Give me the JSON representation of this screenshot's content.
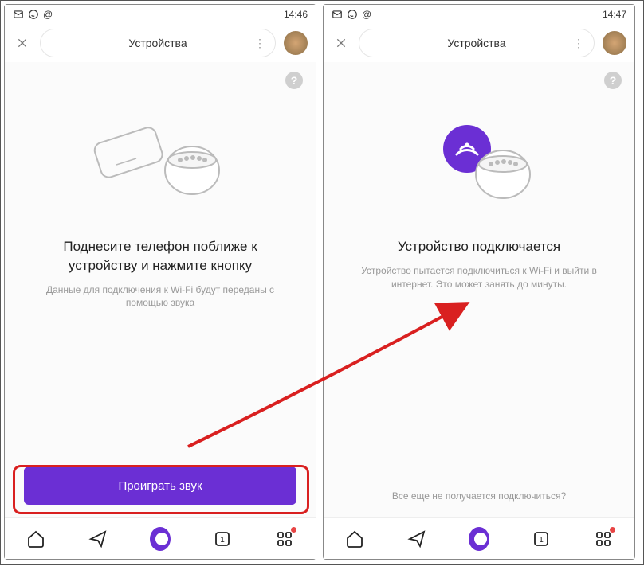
{
  "left": {
    "status": {
      "time": "14:46"
    },
    "header": {
      "title": "Устройства"
    },
    "title": "Поднесите телефон поближе к устройству и нажмите кнопку",
    "subtitle": "Данные для подключения к Wi-Fi будут переданы с помощью звука",
    "button": "Проиграть звук"
  },
  "right": {
    "status": {
      "time": "14:47"
    },
    "header": {
      "title": "Устройства"
    },
    "title": "Устройство подключается",
    "subtitle": "Устройство пытается подключиться к Wi-Fi и выйти в интернет. Это может занять до минуты.",
    "footer_link": "Все еще не получается подключиться?"
  },
  "colors": {
    "accent": "#6b2fd4",
    "highlight": "#d92020"
  }
}
